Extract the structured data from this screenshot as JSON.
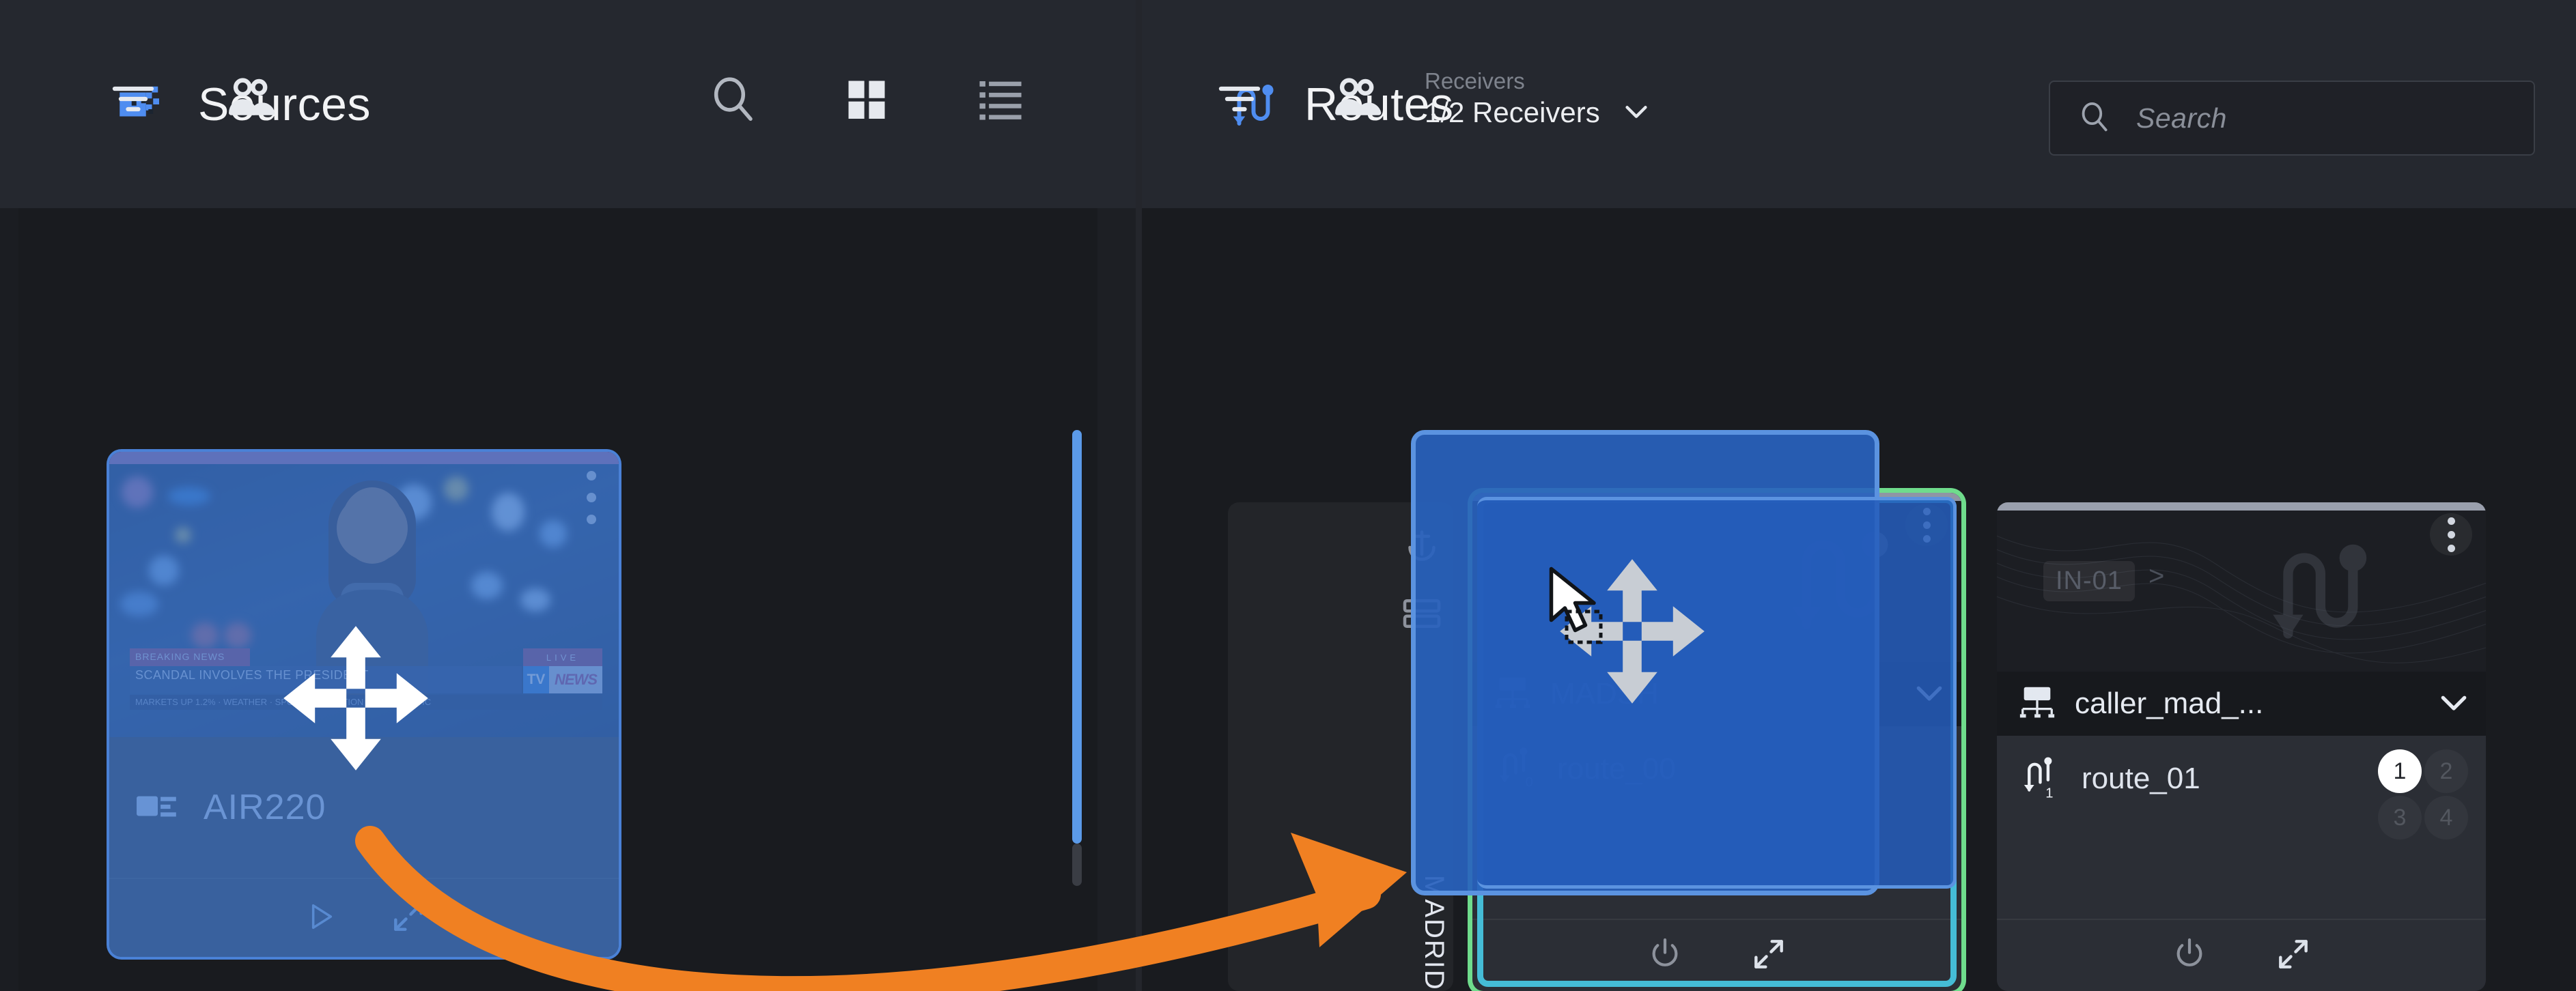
{
  "colors": {
    "accent_blue": "#5b9ae8",
    "drop_target_green": "#6fdc8c",
    "highlight_cyan": "#45bcd6",
    "drag_overlay_blue": "#2862be",
    "annotation_orange": "#f08022",
    "panel_bg": "#191b1f",
    "header_bg": "#25282f"
  },
  "panels": {
    "sources": {
      "title": "Sources",
      "icon": "pixelated-source-icon",
      "toolbar": {
        "filter": "filter-icon",
        "group": "people-icon",
        "search": "search-icon",
        "grid_view": "grid-view-icon",
        "list_view": "list-view-icon"
      }
    },
    "routes": {
      "title": "Routes",
      "icon": "route-icon",
      "toolbar": {
        "filter": "filter-icon",
        "group": "people-icon"
      },
      "receivers": {
        "label": "Receivers",
        "value": "1/2 Receivers",
        "chevron": "chevron-down-icon"
      },
      "search": {
        "placeholder": "Search",
        "value": "",
        "icon": "search-icon"
      }
    }
  },
  "source_card": {
    "name": "AIR220",
    "icon": "source-input-icon",
    "selected": true,
    "menu": "kebab-menu-icon",
    "play": "play-icon",
    "expand": "expand-icon",
    "thumbnail": {
      "tag": "BREAKING NEWS",
      "headline": "SCANDAL INVOLVES THE PRESIDENT",
      "ticker": "MARKETS UP 1.2% · WEATHER · SPORTS · ELECTION 2024 · TRAFFIC",
      "live_badge": "LIVE",
      "logo_tv": "TV",
      "logo_news": "NEWS"
    }
  },
  "route_cards": [
    {
      "hidden_label": "MADRID",
      "icons": [
        "anchor-icon",
        "stack-icon"
      ]
    },
    {
      "badge": "",
      "separator": "",
      "name": "MADSH",
      "name_icon": "ip-network-icon",
      "chevron": "chevron-down-icon",
      "route_label": "route_00",
      "route_icon": "route-out-icon",
      "menu": "kebab-menu-icon",
      "power": "power-icon",
      "expand": "expand-icon",
      "drop_target": true,
      "grid": []
    },
    {
      "badge": "IN-01",
      "separator": ">",
      "name": "caller_mad_...",
      "name_icon": "ip-network-icon",
      "chevron": "chevron-down-icon",
      "route_label": "route_01",
      "route_icon": "route-out-icon",
      "menu": "kebab-menu-icon",
      "power": "power-icon",
      "expand": "expand-icon",
      "drop_target": false,
      "grid": [
        "1",
        "2",
        "3",
        "4"
      ],
      "grid_active": "1"
    }
  ],
  "annotation": {
    "arrow": "drag-drop-arrow",
    "cursor": "move-cursor",
    "pointer": "pointer-arrow-icon"
  }
}
